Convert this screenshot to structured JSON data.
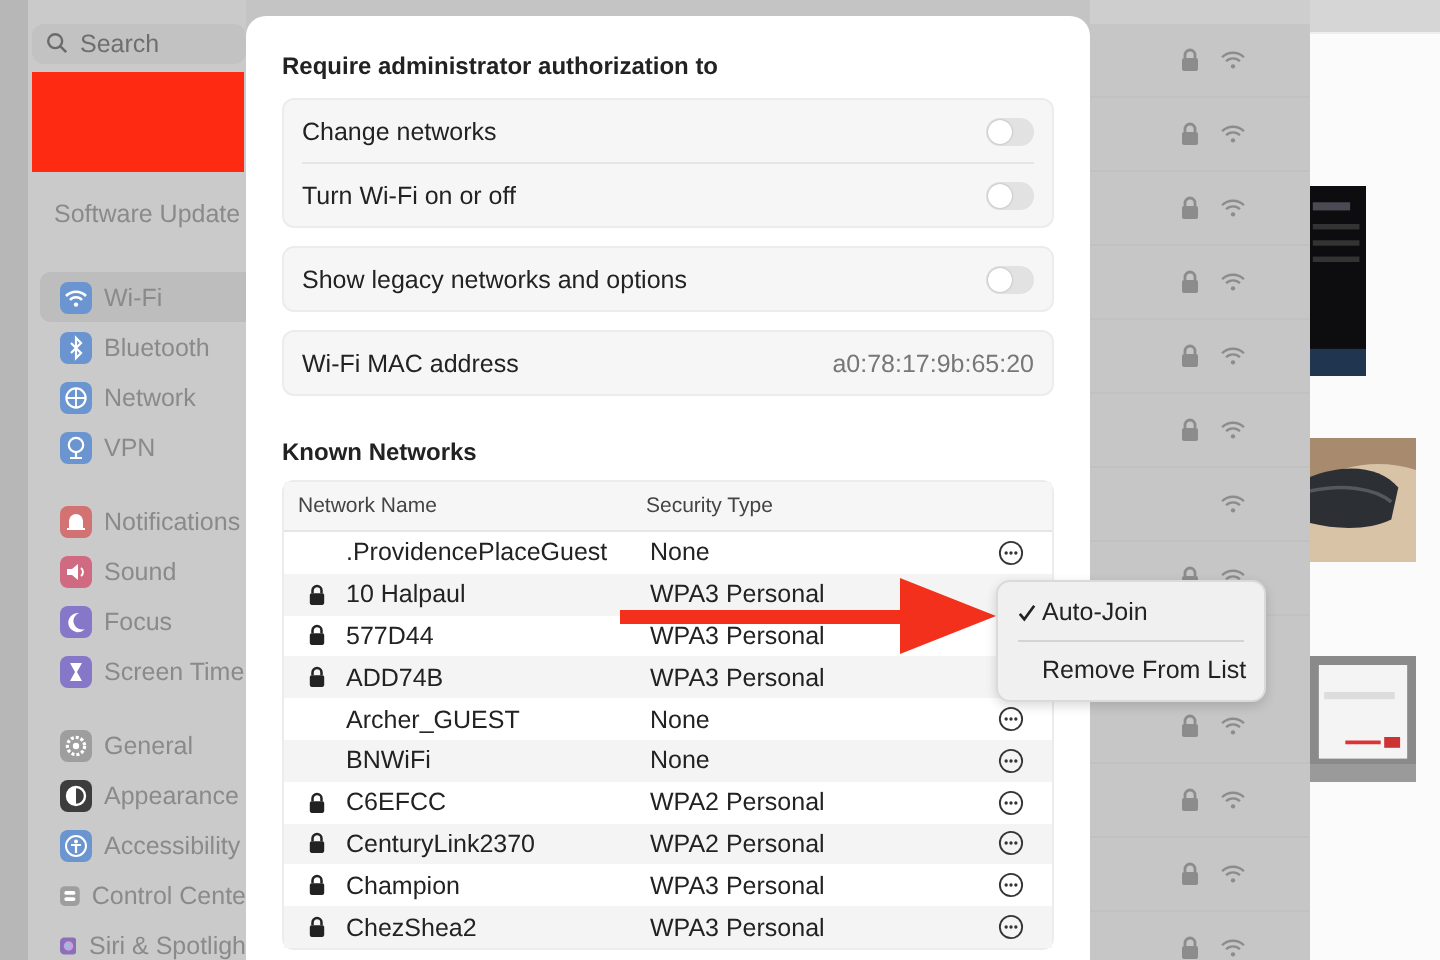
{
  "sidebar": {
    "search": {
      "placeholder": "Search"
    },
    "software_update": "Software Update",
    "groups": [
      [
        {
          "label": "Wi-Fi",
          "kind": "wifi",
          "color": "#6b95d0",
          "selected": true
        },
        {
          "label": "Bluetooth",
          "kind": "bluetooth",
          "color": "#6b95d0",
          "selected": false
        },
        {
          "label": "Network",
          "kind": "globe",
          "color": "#6b95d0",
          "selected": false
        },
        {
          "label": "VPN",
          "kind": "vpn",
          "color": "#6b95d0",
          "selected": false
        }
      ],
      [
        {
          "label": "Notifications",
          "kind": "bell",
          "color": "#d37272",
          "selected": false
        },
        {
          "label": "Sound",
          "kind": "speaker",
          "color": "#d06a83",
          "selected": false
        },
        {
          "label": "Focus",
          "kind": "moon",
          "color": "#8677c9",
          "selected": false
        },
        {
          "label": "Screen Time",
          "kind": "hourglass",
          "color": "#8677c9",
          "selected": false
        }
      ],
      [
        {
          "label": "General",
          "kind": "gear",
          "color": "#9e9e9e",
          "selected": false
        },
        {
          "label": "Appearance",
          "kind": "contrast",
          "color": "#3d3d3d",
          "selected": false
        },
        {
          "label": "Accessibility",
          "kind": "person",
          "color": "#6b95d0",
          "selected": false
        },
        {
          "label": "Control Cente",
          "kind": "switches",
          "color": "#9e9e9e",
          "selected": false
        },
        {
          "label": "Siri & Spotligh",
          "kind": "orb",
          "color": "#8a70b8",
          "selected": false
        }
      ]
    ]
  },
  "dialog": {
    "auth_heading": "Require administrator authorization to",
    "auth_options": [
      {
        "label": "Change networks",
        "on": false
      },
      {
        "label": "Turn Wi-Fi on or off",
        "on": false
      }
    ],
    "legacy": {
      "label": "Show legacy networks and options",
      "on": false
    },
    "mac": {
      "label": "Wi-Fi MAC address",
      "value": "a0:78:17:9b:65:20"
    },
    "known_heading": "Known Networks",
    "table": {
      "columns": [
        "Network Name",
        "Security Type"
      ],
      "rows": [
        {
          "name": ".ProvidencePlaceGuest",
          "security": "None",
          "locked": false
        },
        {
          "name": "10 Halpaul",
          "security": "WPA3 Personal",
          "locked": true
        },
        {
          "name": "577D44",
          "security": "WPA3 Personal",
          "locked": true
        },
        {
          "name": "ADD74B",
          "security": "WPA3 Personal",
          "locked": true
        },
        {
          "name": "Archer_GUEST",
          "security": "None",
          "locked": false
        },
        {
          "name": "BNWiFi",
          "security": "None",
          "locked": false
        },
        {
          "name": "C6EFCC",
          "security": "WPA2 Personal",
          "locked": true
        },
        {
          "name": "CenturyLink2370",
          "security": "WPA2 Personal",
          "locked": true
        },
        {
          "name": "Champion",
          "security": "WPA3 Personal",
          "locked": true
        },
        {
          "name": "ChezShea2",
          "security": "WPA3 Personal",
          "locked": true
        }
      ]
    }
  },
  "context_menu": [
    {
      "label": "Auto-Join",
      "checked": true
    },
    {
      "label": "Remove From List",
      "checked": false
    }
  ],
  "nearby_networks": [
    {
      "locked": true
    },
    {
      "locked": true
    },
    {
      "locked": true
    },
    {
      "locked": true
    },
    {
      "locked": true
    },
    {
      "locked": true
    },
    {
      "locked": false
    },
    {
      "locked": true
    },
    {
      "locked": true
    },
    {
      "locked": true
    },
    {
      "locked": true
    },
    {
      "locked": true
    }
  ]
}
